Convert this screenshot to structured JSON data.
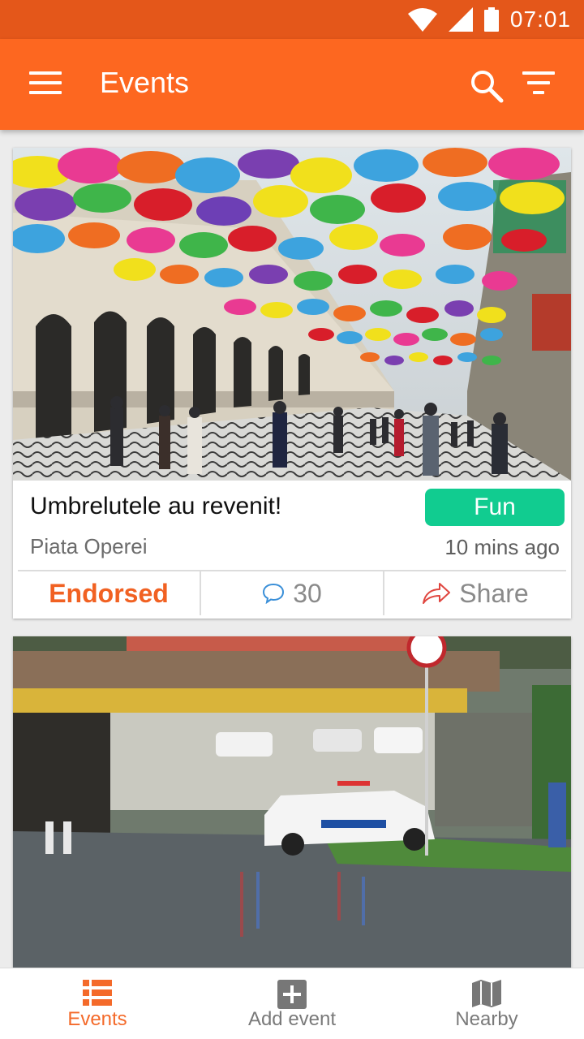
{
  "status_bar": {
    "time": "07:01"
  },
  "app_bar": {
    "title": "Events",
    "menu_icon": "hamburger-menu-icon",
    "search_icon": "search-icon",
    "filter_icon": "filter-icon"
  },
  "cards": [
    {
      "image_description": "Street with colorful umbrellas hanging above",
      "title": "Umbrelutele au revenit!",
      "tag": "Fun",
      "tag_color": "#11cc90",
      "location": "Piata Operei",
      "time": "10 mins ago",
      "endorsed_label": "Endorsed",
      "comment_count": "30",
      "share_label": "Share"
    },
    {
      "image_description": "Flooded underpass with police cars"
    }
  ],
  "bottom_nav": {
    "items": [
      {
        "label": "Events",
        "icon": "list-icon",
        "active": true
      },
      {
        "label": "Add event",
        "icon": "add-box-icon",
        "active": false
      },
      {
        "label": "Nearby",
        "icon": "map-icon",
        "active": false
      }
    ]
  },
  "colors": {
    "primary": "#fd6720",
    "primary_dark": "#e4571a",
    "accent_endorsed": "#f16122",
    "tag_green": "#11cc90"
  }
}
